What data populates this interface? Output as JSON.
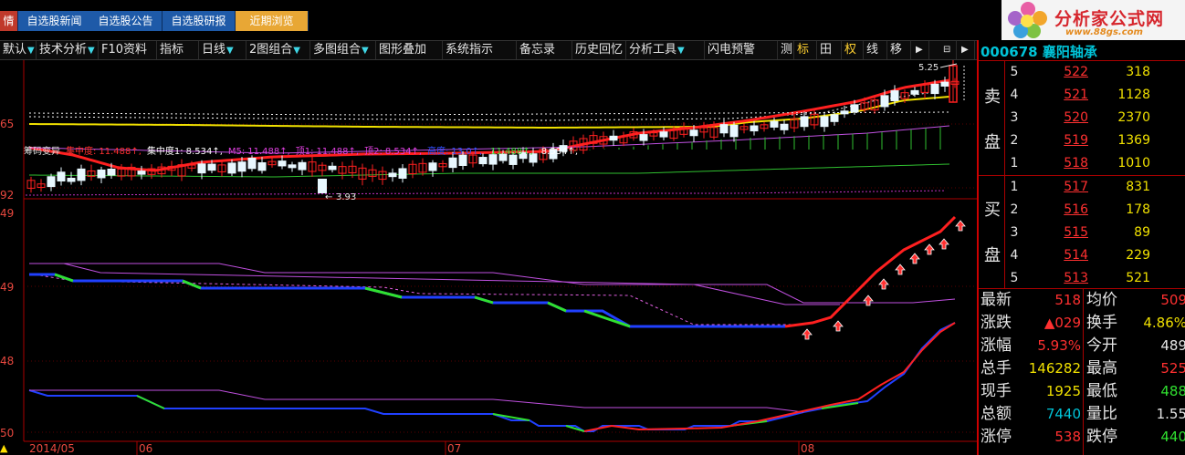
{
  "tabs": [
    {
      "label": "情",
      "state": "first"
    },
    {
      "label": "自选股新闻",
      "state": ""
    },
    {
      "label": "自选股公告",
      "state": ""
    },
    {
      "label": "自选股研报",
      "state": ""
    },
    {
      "label": "近期浏览",
      "state": "active"
    }
  ],
  "logo": {
    "title": "分析家公式网",
    "url": "www.88gs.com"
  },
  "toolbar": [
    {
      "label": "默认",
      "dd": true
    },
    {
      "label": "技术分析",
      "dd": true
    },
    {
      "label": "F10资料",
      "dd": false
    },
    {
      "label": "指标",
      "dd": false
    },
    {
      "label": "日线",
      "dd": true
    },
    {
      "label": "2图组合",
      "dd": true
    },
    {
      "label": "多图组合",
      "dd": true
    },
    {
      "label": "图形叠加",
      "dd": false
    },
    {
      "label": "系统指示",
      "dd": false
    },
    {
      "label": "备忘录",
      "dd": false
    },
    {
      "label": "历史回忆",
      "dd": false
    },
    {
      "label": "分析工具",
      "dd": true
    },
    {
      "label": "闪电预警",
      "dd": false
    },
    {
      "label": "测",
      "dd": false
    },
    {
      "label": "标",
      "dd": false
    },
    {
      "label": "田",
      "dd": false
    },
    {
      "label": "权",
      "dd": false
    },
    {
      "label": "线",
      "dd": false
    },
    {
      "label": "移",
      "dd": false
    }
  ],
  "chart": {
    "price_high_label": "5.25",
    "price_low_label": "3.93",
    "y_labels": {
      "upper": [
        "65",
        "92"
      ],
      "lower": [
        "49",
        "49",
        "48",
        "50"
      ]
    },
    "date_labels": [
      "2014/05",
      "06",
      "07",
      "08"
    ],
    "indicator": {
      "name": "筹码变异",
      "items": [
        {
          "label": "集中度:",
          "value": "11.488",
          "color": "#ff3030"
        },
        {
          "label": "集中度1:",
          "value": "8.534",
          "color": "#ffffff"
        },
        {
          "label": "M5:",
          "value": "11.488",
          "color": "#e040e0"
        },
        {
          "label": "顶1:",
          "value": "11.488",
          "color": "#e040e0"
        },
        {
          "label": "顶2:",
          "value": "8.534",
          "color": "#e040e0"
        },
        {
          "label": "高度:",
          "value": "13.0",
          "color": "#3050ff"
        },
        {
          "label": "",
          "value": "11.488",
          "color": "#40e040"
        },
        {
          "label": "",
          "value": "8.534",
          "color": "#ffffff"
        }
      ]
    }
  },
  "quote": {
    "code": "000678 襄阳轴承",
    "sell_label": [
      "卖",
      "盘"
    ],
    "buy_label": [
      "买",
      "盘"
    ],
    "sell": [
      {
        "level": "5",
        "price": "522",
        "vol": "318"
      },
      {
        "level": "4",
        "price": "521",
        "vol": "1128"
      },
      {
        "level": "3",
        "price": "520",
        "vol": "2370"
      },
      {
        "level": "2",
        "price": "519",
        "vol": "1369"
      },
      {
        "level": "1",
        "price": "518",
        "vol": "1010"
      }
    ],
    "buy": [
      {
        "level": "1",
        "price": "517",
        "vol": "831"
      },
      {
        "level": "2",
        "price": "516",
        "vol": "178"
      },
      {
        "level": "3",
        "price": "515",
        "vol": "89"
      },
      {
        "level": "4",
        "price": "514",
        "vol": "229"
      },
      {
        "level": "5",
        "price": "513",
        "vol": "521"
      }
    ],
    "stats": [
      {
        "l1": "最新",
        "v1": "518",
        "c1": "#ff3030",
        "l2": "均价",
        "v2": "509",
        "c2": "#ff3030"
      },
      {
        "l1": "涨跌",
        "v1": "▲029",
        "c1": "#ff3030",
        "l2": "换手",
        "v2": "4.86%",
        "c2": "#f0e000"
      },
      {
        "l1": "涨幅",
        "v1": "5.93%",
        "c1": "#ff3030",
        "l2": "今开",
        "v2": "489",
        "c2": "#e6e6e6"
      },
      {
        "l1": "总手",
        "v1": "146282",
        "c1": "#f0e000",
        "l2": "最高",
        "v2": "525",
        "c2": "#ff3030"
      },
      {
        "l1": "现手",
        "v1": "1925",
        "c1": "#f0e000",
        "l2": "最低",
        "v2": "488",
        "c2": "#30e030"
      },
      {
        "l1": "总额",
        "v1": "7440",
        "c1": "#00c4d8",
        "l2": "量比",
        "v2": "1.55",
        "c2": "#e6e6e6"
      },
      {
        "l1": "涨停",
        "v1": "538",
        "c1": "#ff3030",
        "l2": "跌停",
        "v2": "440",
        "c2": "#30e030"
      }
    ]
  }
}
